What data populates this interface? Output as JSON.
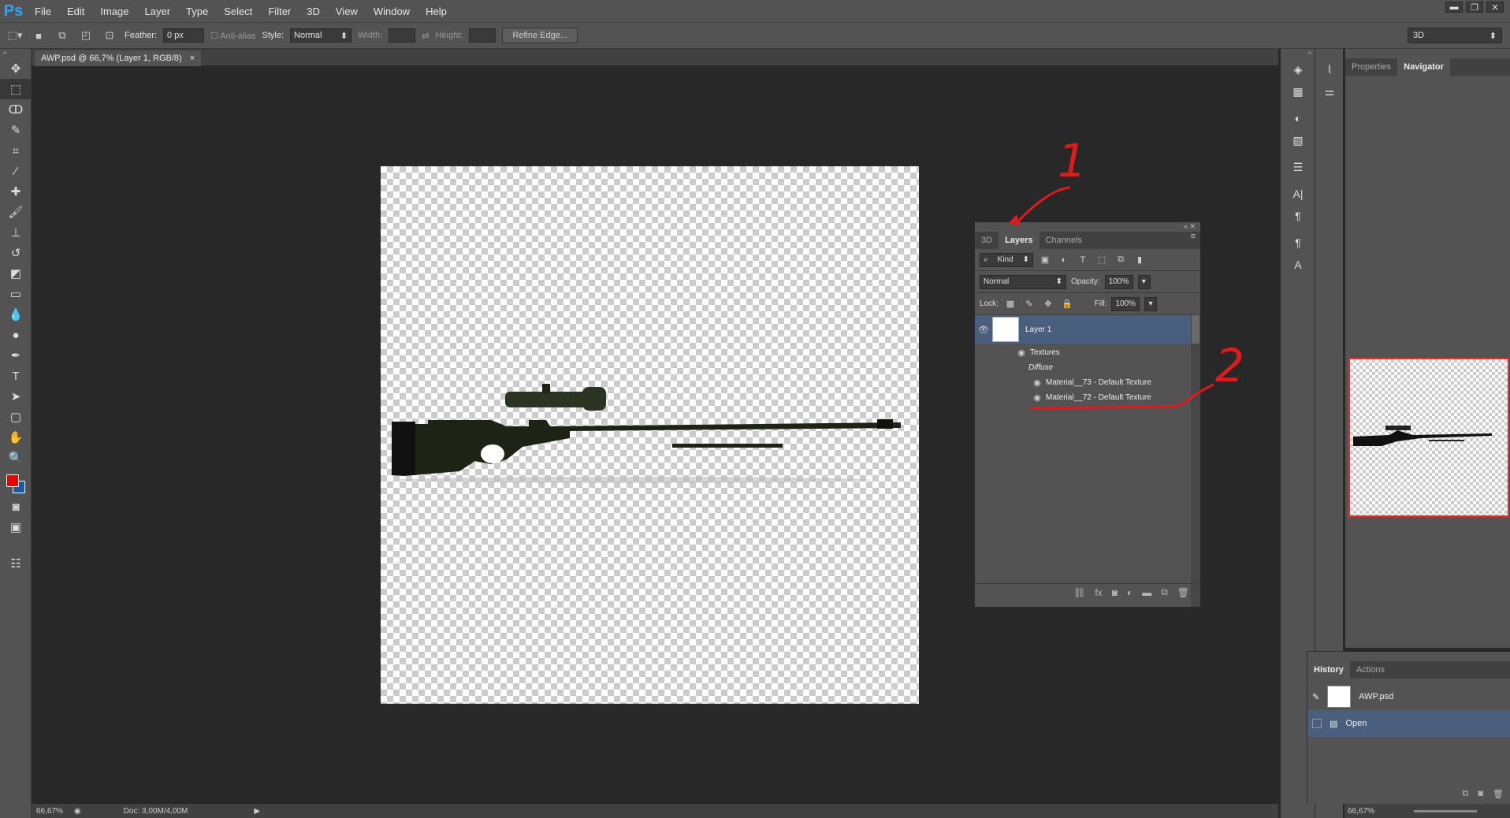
{
  "app": {
    "logo": "Ps"
  },
  "menu": [
    "File",
    "Edit",
    "Image",
    "Layer",
    "Type",
    "Select",
    "Filter",
    "3D",
    "View",
    "Window",
    "Help"
  ],
  "options": {
    "feather_label": "Feather:",
    "feather_value": "0 px",
    "antialias_label": "Anti-alias",
    "style_label": "Style:",
    "style_value": "Normal",
    "width_label": "Width:",
    "height_label": "Height:",
    "refine_edge": "Refine Edge...",
    "workspace": "3D"
  },
  "document": {
    "tab_title": "AWP.psd @ 66,7% (Layer 1, RGB/8)",
    "close": "×"
  },
  "status": {
    "zoom": "66,67%",
    "doc_size": "Doc: 3,00M/4,00M"
  },
  "right_panel": {
    "tab_properties": "Properties",
    "tab_navigator": "Navigator",
    "nav_zoom": "66,67%"
  },
  "history": {
    "tab_history": "History",
    "tab_actions": "Actions",
    "snapshot": "AWP.psd",
    "step": "Open"
  },
  "layers_panel": {
    "tab_3d": "3D",
    "tab_layers": "Layers",
    "tab_channels": "Channels",
    "filter_kind": "Kind",
    "blend_mode": "Normal",
    "opacity_label": "Opacity:",
    "opacity_value": "100%",
    "lock_label": "Lock:",
    "fill_label": "Fill:",
    "fill_value": "100%",
    "layer_name": "Layer 1",
    "textures_label": "Textures",
    "diffuse_label": "Diffuse",
    "material_73": "Material__73 - Default Texture",
    "material_72": "Material__72 - Default Texture"
  },
  "annotations": {
    "one": "1",
    "two": "2",
    "color": "#e01a1a"
  }
}
